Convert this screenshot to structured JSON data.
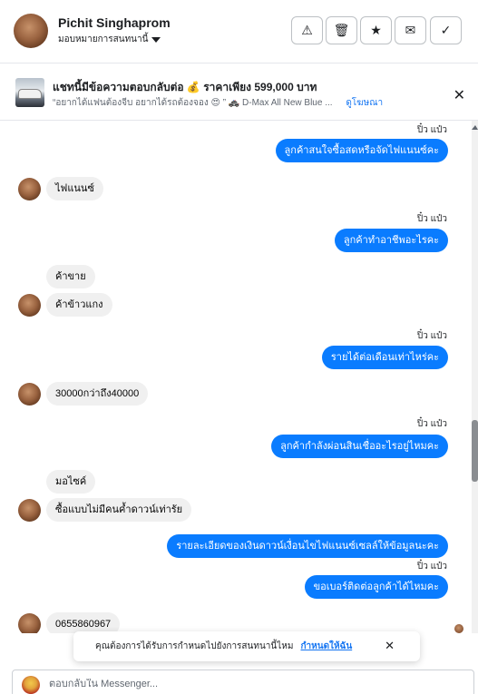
{
  "header": {
    "contact_name": "Pichit Singhaprom",
    "assign_label": "มอบหมายการสนทนานี้",
    "actions": [
      {
        "icon": "warning-icon",
        "glyph": "⚠"
      },
      {
        "icon": "trash-icon",
        "glyph": "🗑"
      },
      {
        "icon": "star-icon",
        "glyph": "★"
      },
      {
        "icon": "mail-icon",
        "glyph": "✉"
      },
      {
        "icon": "check-icon",
        "glyph": "✓"
      }
    ]
  },
  "promo": {
    "title": "แชทนี้มีข้อความตอบกลับต่อ 💰 ราคาเพียง 599,000 บาท",
    "subtitle": "“อยากได้แฟนต้องจีบ อยากได้รถต้องจอง 😍 ” 🚓 D-Max All New Blue ...",
    "link": "ดูโฆษณา",
    "close": "✕"
  },
  "messages": [
    {
      "kind": "seen",
      "text": "ปิ๋ว แป๋ว"
    },
    {
      "kind": "out",
      "text": "ลูกค้าสนใจซื้อสดหรือจัดไฟแนนซ์คะ"
    },
    {
      "kind": "in",
      "text": "ไฟแนนซ์"
    },
    {
      "kind": "seen",
      "text": "ปิ๋ว แป๋ว"
    },
    {
      "kind": "out",
      "text": "ลูกค้าทำอาชีพอะไรคะ"
    },
    {
      "kind": "in",
      "text": "ค้าขาย"
    },
    {
      "kind": "in",
      "text": "ค้าข้าวแกง"
    },
    {
      "kind": "seen",
      "text": "ปิ๋ว แป๋ว"
    },
    {
      "kind": "out",
      "text": "รายได้ต่อเดือนเท่าไหร่คะ"
    },
    {
      "kind": "in",
      "text": "30000กว่าถึง40000"
    },
    {
      "kind": "seen",
      "text": "ปิ๋ว แป๋ว"
    },
    {
      "kind": "out",
      "text": "ลูกค้ากำลังผ่อนสินเชื่ออะไรอยู่ไหมคะ"
    },
    {
      "kind": "in",
      "text": "มอไซค์"
    },
    {
      "kind": "in",
      "text": "ซื้อแบบไม่มีคนค้ำดาวน์เท่ารัย"
    },
    {
      "kind": "out",
      "text": "รายละเอียดของเงินดาวน์เงื่อนไขไฟแนนซ์เซลล์ให้ข้อมูลนะคะ"
    },
    {
      "kind": "seen",
      "text": "ปิ๋ว แป๋ว"
    },
    {
      "kind": "out",
      "text": "ขอเบอร์ติดต่อลูกค้าได้ไหมคะ"
    },
    {
      "kind": "in",
      "text": "0655860967"
    }
  ],
  "toast": {
    "text": "คุณต้องการได้รับการกำหนดไปยังการสนทนานี้ไหม",
    "link": "กำหนดให้ฉัน",
    "close": "✕"
  },
  "composer": {
    "placeholder": "ตอบกลับใน Messenger..."
  }
}
